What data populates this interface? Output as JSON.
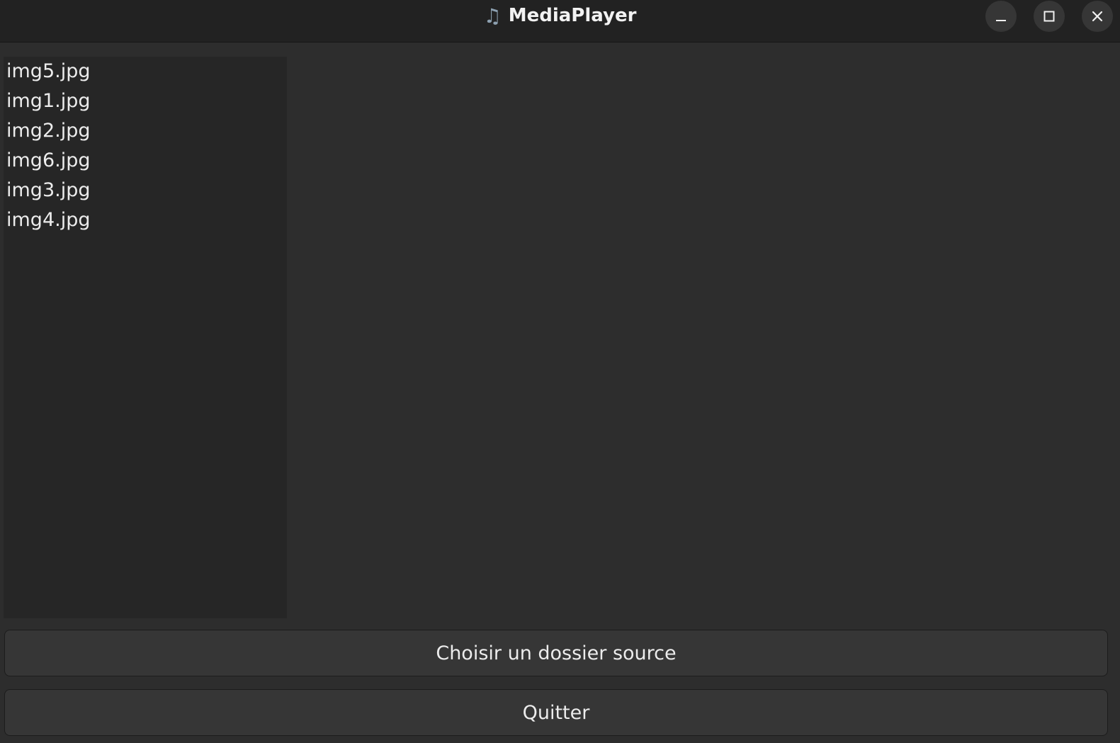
{
  "window": {
    "title": "MediaPlayer",
    "app_icon": "♫",
    "controls": {
      "minimize_icon": "minimize-icon",
      "maximize_icon": "maximize-icon",
      "close_icon": "close-icon"
    }
  },
  "file_list": {
    "items": [
      {
        "label": "img5.jpg"
      },
      {
        "label": "img1.jpg"
      },
      {
        "label": "img2.jpg"
      },
      {
        "label": "img6.jpg"
      },
      {
        "label": "img3.jpg"
      },
      {
        "label": "img4.jpg"
      }
    ]
  },
  "actions": {
    "choose_source_label": "Choisir un dossier source",
    "quit_label": "Quitter"
  },
  "colors": {
    "titlebar": "#222222",
    "window_bg": "#2d2d2d",
    "list_bg": "#262626",
    "button_bg": "#363636",
    "text": "#ececec"
  }
}
